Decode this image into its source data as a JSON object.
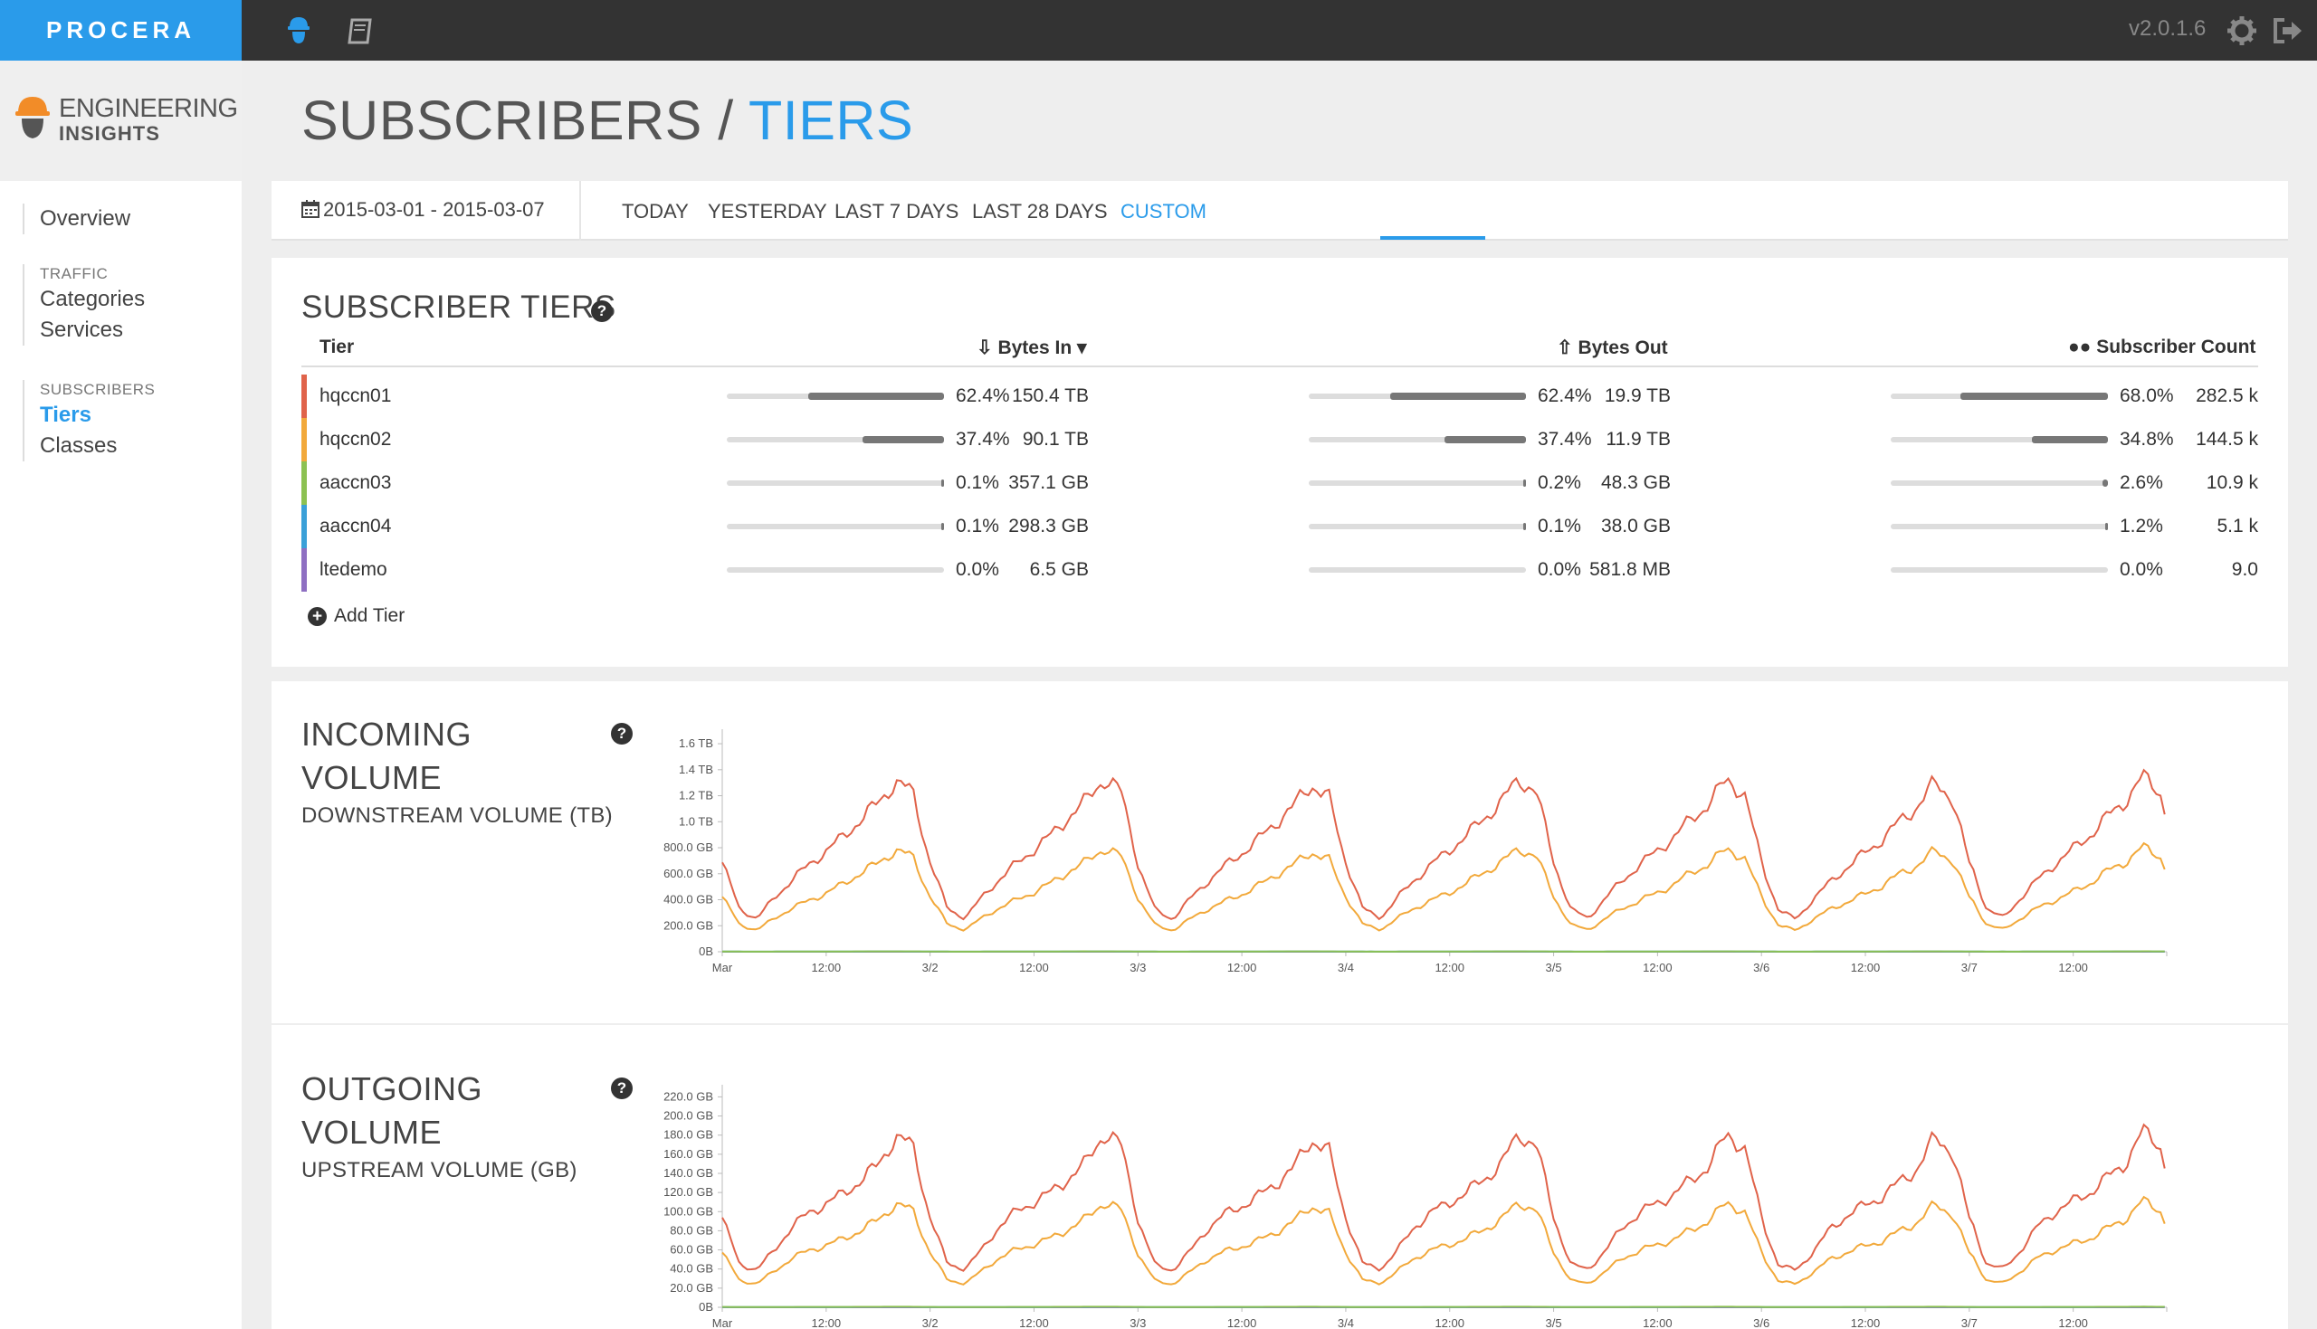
{
  "app": {
    "brand": "PROCERA",
    "version": "v2.0.1.6",
    "product_line1": "ENGINEERING",
    "product_line2": "INSIGHTS",
    "accent_color": "#2a9bea"
  },
  "topbar": {
    "icons": [
      "engineer-icon",
      "book-icon",
      "gear-icon",
      "logout-icon"
    ]
  },
  "sidebar": {
    "overview": "Overview",
    "traffic_heading": "TRAFFIC",
    "traffic_items": [
      "Categories",
      "Services"
    ],
    "subscribers_heading": "SUBSCRIBERS",
    "subscribers_items": [
      "Tiers",
      "Classes"
    ],
    "active_item": "Tiers"
  },
  "page": {
    "title_main": "SUBSCRIBERS",
    "title_sep": " / ",
    "title_accent": "TIERS"
  },
  "date_filter": {
    "range": "2015-03-01 - 2015-03-07",
    "tabs": [
      "TODAY",
      "YESTERDAY",
      "LAST 7 DAYS",
      "LAST 28 DAYS",
      "CUSTOM"
    ],
    "active_tab": "CUSTOM"
  },
  "tiers_table": {
    "title": "SUBSCRIBER TIERS",
    "col_tier": "Tier",
    "col_bytes_in": "Bytes In",
    "col_bytes_out": "Bytes Out",
    "col_subscriber_count": "Subscriber Count",
    "sort_column": "Bytes In",
    "add_label": "Add Tier",
    "rows": [
      {
        "name": "hqccn01",
        "color": "#e0634a",
        "in_pct": "62.4%",
        "in_val": "150.4 TB",
        "in_frac": 0.624,
        "out_pct": "62.4%",
        "out_val": "19.9 TB",
        "out_frac": 0.624,
        "sub_pct": "68.0%",
        "sub_val": "282.5 k",
        "sub_frac": 0.68
      },
      {
        "name": "hqccn02",
        "color": "#f2a93b",
        "in_pct": "37.4%",
        "in_val": "90.1 TB",
        "in_frac": 0.374,
        "out_pct": "37.4%",
        "out_val": "11.9 TB",
        "out_frac": 0.374,
        "sub_pct": "34.8%",
        "sub_val": "144.5 k",
        "sub_frac": 0.348
      },
      {
        "name": "aaccn03",
        "color": "#8cc152",
        "in_pct": "0.1%",
        "in_val": "357.1 GB",
        "in_frac": 0.001,
        "out_pct": "0.2%",
        "out_val": "48.3 GB",
        "out_frac": 0.002,
        "sub_pct": "2.6%",
        "sub_val": "10.9 k",
        "sub_frac": 0.026
      },
      {
        "name": "aaccn04",
        "color": "#3aa0d8",
        "in_pct": "0.1%",
        "in_val": "298.3 GB",
        "in_frac": 0.001,
        "out_pct": "0.1%",
        "out_val": "38.0 GB",
        "out_frac": 0.001,
        "sub_pct": "1.2%",
        "sub_val": "5.1 k",
        "sub_frac": 0.012
      },
      {
        "name": "ltedemo",
        "color": "#8e6fc2",
        "in_pct": "0.0%",
        "in_val": "6.5 GB",
        "in_frac": 0.0,
        "out_pct": "0.0%",
        "out_val": "581.8 MB",
        "out_frac": 0.0,
        "sub_pct": "0.0%",
        "sub_val": "9.0",
        "sub_frac": 0.0
      }
    ]
  },
  "incoming": {
    "title_line1": "INCOMING",
    "title_line2": "VOLUME",
    "subtitle": "DOWNSTREAM VOLUME (TB)"
  },
  "outgoing": {
    "title_line1": "OUTGOING",
    "title_line2": "VOLUME",
    "subtitle": "UPSTREAM VOLUME (GB)"
  },
  "chart_data": [
    {
      "type": "line",
      "title": "",
      "xlabel": "",
      "ylabel": "",
      "x_ticks": [
        "Mar",
        "12:00",
        "3/2",
        "12:00",
        "3/3",
        "12:00",
        "3/4",
        "12:00",
        "3/5",
        "12:00",
        "3/6",
        "12:00",
        "3/7",
        "12:00"
      ],
      "x_range_days": [
        0,
        6.95
      ],
      "ylim_gb": [
        0,
        1700
      ],
      "y_ticks": [
        "0B",
        "200.0 GB",
        "400.0 GB",
        "600.0 GB",
        "800.0 GB",
        "1.0 TB",
        "1.2 TB",
        "1.4 TB",
        "1.6 TB"
      ],
      "daily_profile": {
        "hours": [
          0,
          2,
          4,
          6,
          8,
          10,
          12,
          14,
          16,
          18,
          20,
          22,
          24
        ],
        "series": [
          {
            "tier": "hqccn01",
            "color": "#e0634a",
            "values_gb": [
              700,
              330,
              260,
              420,
              560,
              680,
              790,
              900,
              1040,
              1160,
              1340,
              1240,
              700
            ]
          },
          {
            "tier": "hqccn02",
            "color": "#f2a93b",
            "values_gb": [
              430,
              210,
              170,
              260,
              340,
              400,
              460,
              530,
              620,
              690,
              800,
              740,
              430
            ]
          },
          {
            "tier": "aaccn03",
            "color": "#8cc152",
            "values_gb": [
              2,
              1,
              1,
              1,
              2,
              2,
              2,
              2,
              3,
              3,
              3,
              3,
              2
            ]
          },
          {
            "tier": "aaccn04",
            "color": "#3aa0d8",
            "values_gb": [
              2,
              1,
              1,
              1,
              2,
              2,
              2,
              2,
              2,
              3,
              3,
              2,
              2
            ]
          },
          {
            "tier": "ltedemo",
            "color": "#8e6fc2",
            "values_gb": [
              0,
              0,
              0,
              0,
              0,
              0,
              0,
              0,
              0,
              0,
              0,
              0,
              0
            ]
          }
        ]
      },
      "grid": false,
      "legend": "none"
    },
    {
      "type": "line",
      "title": "",
      "xlabel": "",
      "ylabel": "",
      "x_ticks": [
        "Mar",
        "12:00",
        "3/2",
        "12:00",
        "3/3",
        "12:00",
        "3/4",
        "12:00",
        "3/5",
        "12:00",
        "3/6",
        "12:00",
        "3/7",
        "12:00"
      ],
      "x_range_days": [
        0,
        6.95
      ],
      "ylim_gb": [
        0,
        230
      ],
      "y_ticks": [
        "0B",
        "20.0 GB",
        "40.0 GB",
        "60.0 GB",
        "80.0 GB",
        "100.0 GB",
        "120.0 GB",
        "140.0 GB",
        "160.0 GB",
        "180.0 GB",
        "200.0 GB",
        "220.0 GB"
      ],
      "daily_profile": {
        "hours": [
          0,
          2,
          4,
          6,
          8,
          10,
          12,
          14,
          16,
          18,
          20,
          22,
          24
        ],
        "series": [
          {
            "tier": "hqccn01",
            "color": "#e0634a",
            "values_gb": [
              95,
              45,
              40,
              60,
              85,
              100,
              110,
              120,
              135,
              150,
              182,
              170,
              95
            ]
          },
          {
            "tier": "hqccn02",
            "color": "#f2a93b",
            "values_gb": [
              58,
              28,
              25,
              38,
              52,
              60,
              66,
              72,
              82,
              92,
              110,
              102,
              58
            ]
          },
          {
            "tier": "aaccn03",
            "color": "#8cc152",
            "values_gb": [
              0.4,
              0.2,
              0.2,
              0.3,
              0.3,
              0.4,
              0.4,
              0.4,
              0.5,
              0.5,
              0.6,
              0.5,
              0.4
            ]
          },
          {
            "tier": "aaccn04",
            "color": "#3aa0d8",
            "values_gb": [
              0.3,
              0.2,
              0.2,
              0.2,
              0.3,
              0.3,
              0.3,
              0.3,
              0.4,
              0.4,
              0.5,
              0.4,
              0.3
            ]
          },
          {
            "tier": "ltedemo",
            "color": "#8e6fc2",
            "values_gb": [
              0,
              0,
              0,
              0,
              0,
              0,
              0,
              0,
              0,
              0,
              0,
              0,
              0
            ]
          }
        ]
      },
      "grid": false,
      "legend": "none"
    }
  ]
}
